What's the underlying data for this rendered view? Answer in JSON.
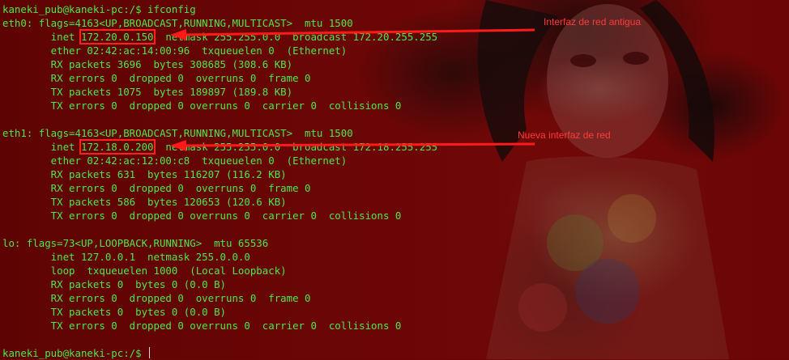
{
  "terminal": {
    "lines": [
      "kaneki_pub@kaneki-pc:/$ ifconfig",
      "eth0: flags=4163<UP,BROADCAST,RUNNING,MULTICAST>  mtu 1500",
      "        inet 172.20.0.150  netmask 255.255.0.0  broadcast 172.20.255.255",
      "        ether 02:42:ac:14:00:96  txqueuelen 0  (Ethernet)",
      "        RX packets 3696  bytes 308685 (308.6 KB)",
      "        RX errors 0  dropped 0  overruns 0  frame 0",
      "        TX packets 1075  bytes 189897 (189.8 KB)",
      "        TX errors 0  dropped 0 overruns 0  carrier 0  collisions 0",
      "",
      "eth1: flags=4163<UP,BROADCAST,RUNNING,MULTICAST>  mtu 1500",
      "        inet 172.18.0.200  netmask 255.255.0.0  broadcast 172.18.255.255",
      "        ether 02:42:ac:12:00:c8  txqueuelen 0  (Ethernet)",
      "        RX packets 631  bytes 116207 (116.2 KB)",
      "        RX errors 0  dropped 0  overruns 0  frame 0",
      "        TX packets 586  bytes 120653 (120.6 KB)",
      "        TX errors 0  dropped 0 overruns 0  carrier 0  collisions 0",
      "",
      "lo: flags=73<UP,LOOPBACK,RUNNING>  mtu 65536",
      "        inet 127.0.0.1  netmask 255.0.0.0",
      "        loop  txqueuelen 1000  (Local Loopback)",
      "        RX packets 0  bytes 0 (0.0 B)",
      "        RX errors 0  dropped 0  overruns 0  frame 0",
      "        TX packets 0  bytes 0 (0.0 B)",
      "        TX errors 0  dropped 0 overruns 0  carrier 0  collisions 0",
      "",
      "kaneki_pub@kaneki-pc:/$ "
    ],
    "highlighted_ips": [
      "172.20.0.150",
      "172.18.0.200"
    ]
  },
  "annotations": {
    "old_interface": "Interfaz de red antigua",
    "new_interface": "Nueva interfaz de red"
  },
  "colors": {
    "text": "#4de84d",
    "annotation": "#ff2020",
    "background": "#6a0505"
  }
}
